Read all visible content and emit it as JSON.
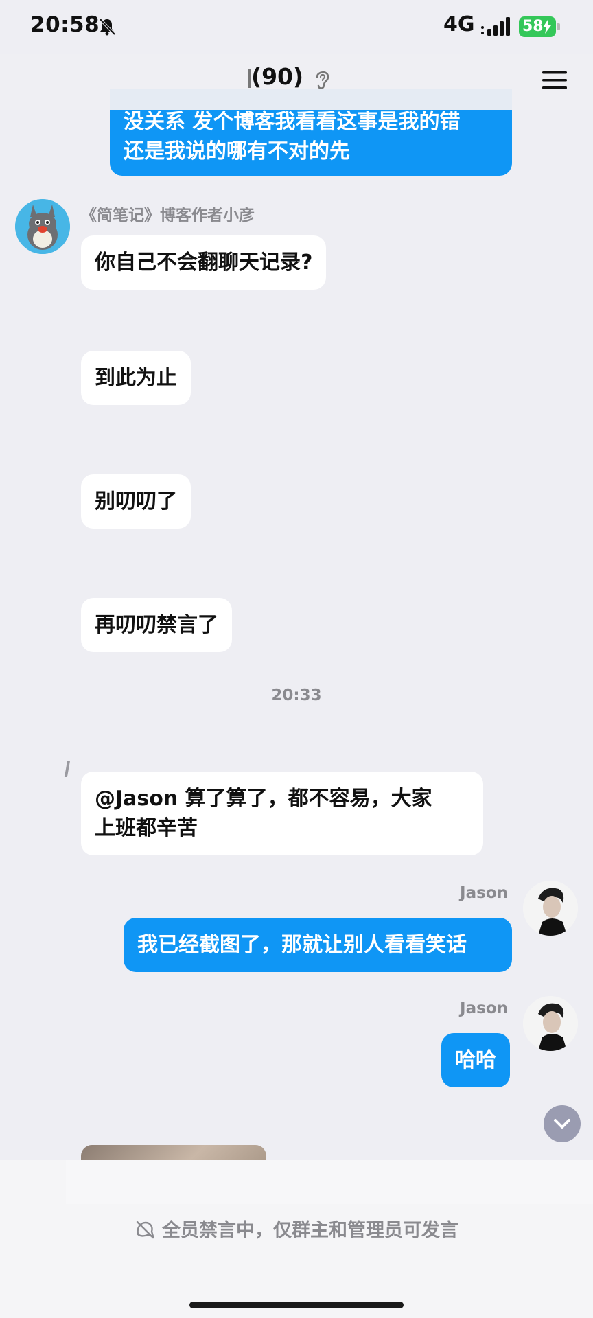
{
  "status_bar": {
    "time": "20:58",
    "network": "4G",
    "battery": "58"
  },
  "header": {
    "title": "(90)"
  },
  "messages": [
    {
      "sender": "",
      "lines": [
        "没关系 发个博客我看看这事是我的错",
        "还是我说的哪有不对的先"
      ]
    },
    {
      "sender": "《简笔记》博客作者小彦",
      "text": "你自己不会翻聊天记录?"
    },
    {
      "sender": "",
      "text": "到此为止"
    },
    {
      "sender": "",
      "text": "别叨叨了"
    },
    {
      "sender": "",
      "text": "再叨叨禁言了"
    },
    {
      "timestamp": "20:33"
    },
    {
      "sender": "",
      "lines": [
        "@Jason 算了算了，都不容易，大家",
        "上班都辛苦"
      ]
    },
    {
      "sender": "Jason",
      "text": "我已经截图了，那就让别人看看笑话"
    },
    {
      "sender": "Jason",
      "text": "哈哈"
    }
  ],
  "footer": {
    "mute_notice": "全员禁言中，仅群主和管理员可发言"
  },
  "icons": {
    "bell": "bell-slash-icon",
    "ear": "ear-icon",
    "menu": "hamburger-menu-icon",
    "scroll": "chevron-down-icon",
    "mute": "mute-icon"
  },
  "colors": {
    "outgoing_bubble": "#0f96f5",
    "incoming_bubble": "#ffffff",
    "background": "#eeeef3"
  }
}
